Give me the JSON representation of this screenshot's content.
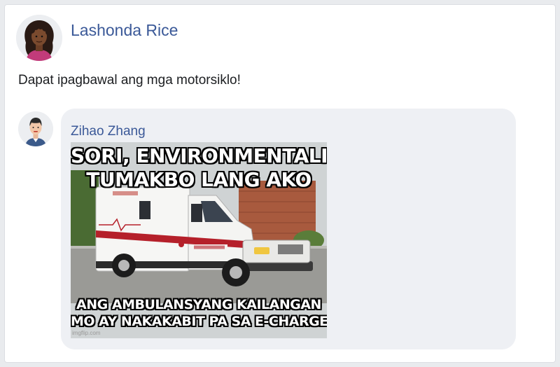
{
  "post": {
    "author_name": "Lashonda Rice",
    "text": "Dapat ipagbawal ang mga motorsiklo!"
  },
  "comment": {
    "author_name": "Zihao Zhang",
    "meme": {
      "top_line_1": "SORI, ENVIRONMENTALIST",
      "top_line_2": "TUMAKBO LANG AKO",
      "bottom_line_1": "ANG AMBULANSYANG KAILANGAN",
      "bottom_line_2": "MO AY NAKAKABIT PA SA E-CHARGER",
      "watermark": "imgflip.com"
    }
  },
  "colors": {
    "link_blue": "#3b5998",
    "bubble_bg": "#eef0f4",
    "ambulance_red": "#b5202a"
  }
}
